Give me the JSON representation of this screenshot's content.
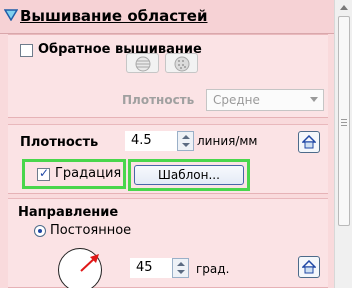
{
  "header": {
    "title": "Вышивание областей",
    "toggle_icon": "triangle-down-icon"
  },
  "reverse": {
    "label": "Обратное вышивание",
    "checked": false
  },
  "pattern_buttons": [
    {
      "icon": "stripes-pattern-icon"
    },
    {
      "icon": "dots-pattern-icon"
    }
  ],
  "density_small": {
    "label": "Плотность",
    "select_value": "Средне"
  },
  "density": {
    "label": "Плотность",
    "value": "4.5",
    "unit": "линия/мм",
    "reset_icon": "home-icon"
  },
  "gradation": {
    "label": "Градация",
    "checked": true,
    "template_button": "Шаблон..."
  },
  "direction": {
    "label": "Направление",
    "radio_label": "Постоянное",
    "selected": true,
    "angle": "45",
    "unit": "град.",
    "reset_icon": "home-icon"
  },
  "colors": {
    "background": "#f9dadc",
    "highlight": "#49d64c",
    "accent": "#1f47a5"
  }
}
